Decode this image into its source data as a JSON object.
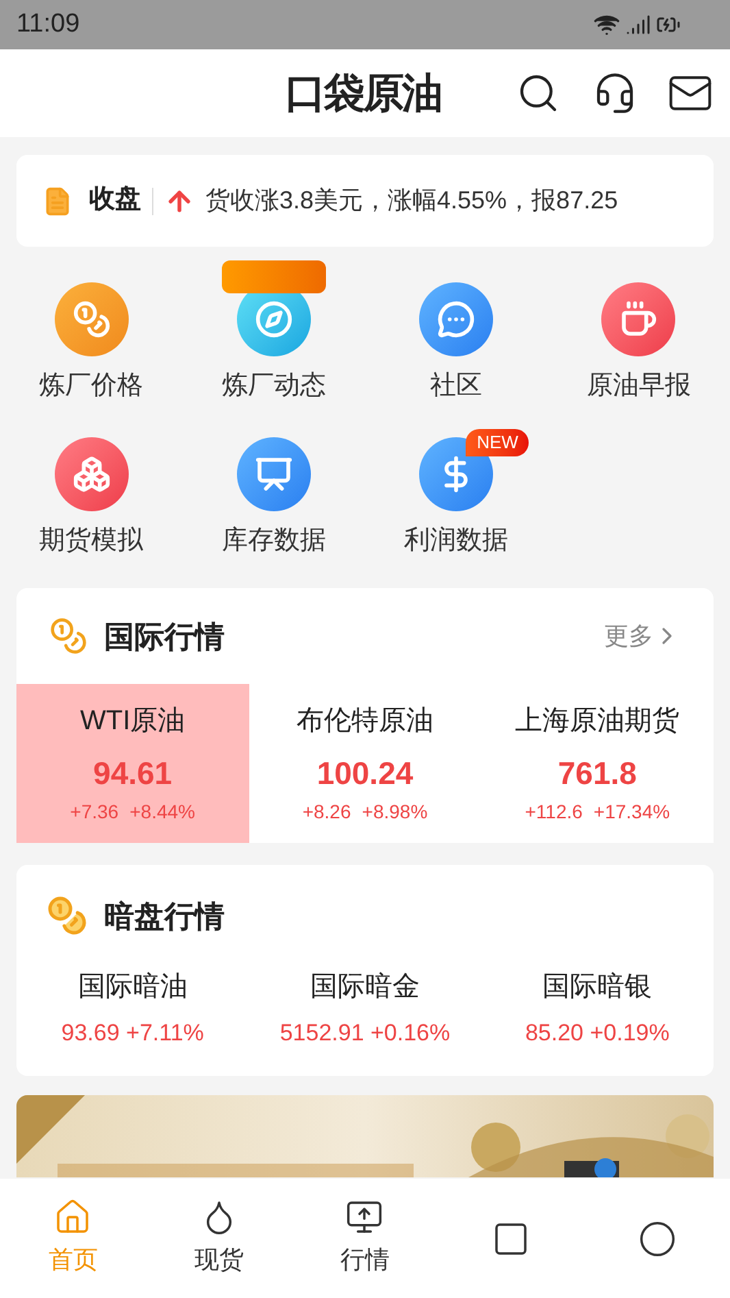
{
  "status_bar": {
    "time": "11:09"
  },
  "header": {
    "logo": "口袋原油"
  },
  "ticker": {
    "label": "收盘",
    "text": "货收涨3.8美元，涨幅4.55%，报87.25"
  },
  "shortcuts": [
    {
      "label": "炼厂价格"
    },
    {
      "label": "炼厂动态",
      "badge": {
        "kind": "blank"
      }
    },
    {
      "label": "社区"
    },
    {
      "label": "原油早报"
    },
    {
      "label": "期货模拟"
    },
    {
      "label": "库存数据"
    },
    {
      "label": "利润数据",
      "badge": {
        "kind": "text",
        "text": "NEW"
      }
    }
  ],
  "international": {
    "title": "国际行情",
    "more": "更多",
    "markets": [
      {
        "name": "WTI原油",
        "price": "94.61",
        "change": "+7.36",
        "percent": "+8.44%",
        "selected": true
      },
      {
        "name": "布伦特原油",
        "price": "100.24",
        "change": "+8.26",
        "percent": "+8.98%",
        "selected": false
      },
      {
        "name": "上海原油期货",
        "price": "761.8",
        "change": "+112.6",
        "percent": "+17.34%",
        "selected": false
      }
    ]
  },
  "dark_market": {
    "title": "暗盘行情",
    "items": [
      {
        "name": "国际暗油",
        "quote": "93.69 +7.11%"
      },
      {
        "name": "国际暗金",
        "quote": "5152.91 +0.16%"
      },
      {
        "name": "国际暗银",
        "quote": "85.20 +0.19%"
      }
    ]
  },
  "bottom_nav": [
    {
      "label": "首页",
      "selected": true
    },
    {
      "label": "现货",
      "selected": false
    },
    {
      "label": "行情",
      "selected": false
    },
    {
      "selected": false
    },
    {
      "selected": false
    }
  ]
}
